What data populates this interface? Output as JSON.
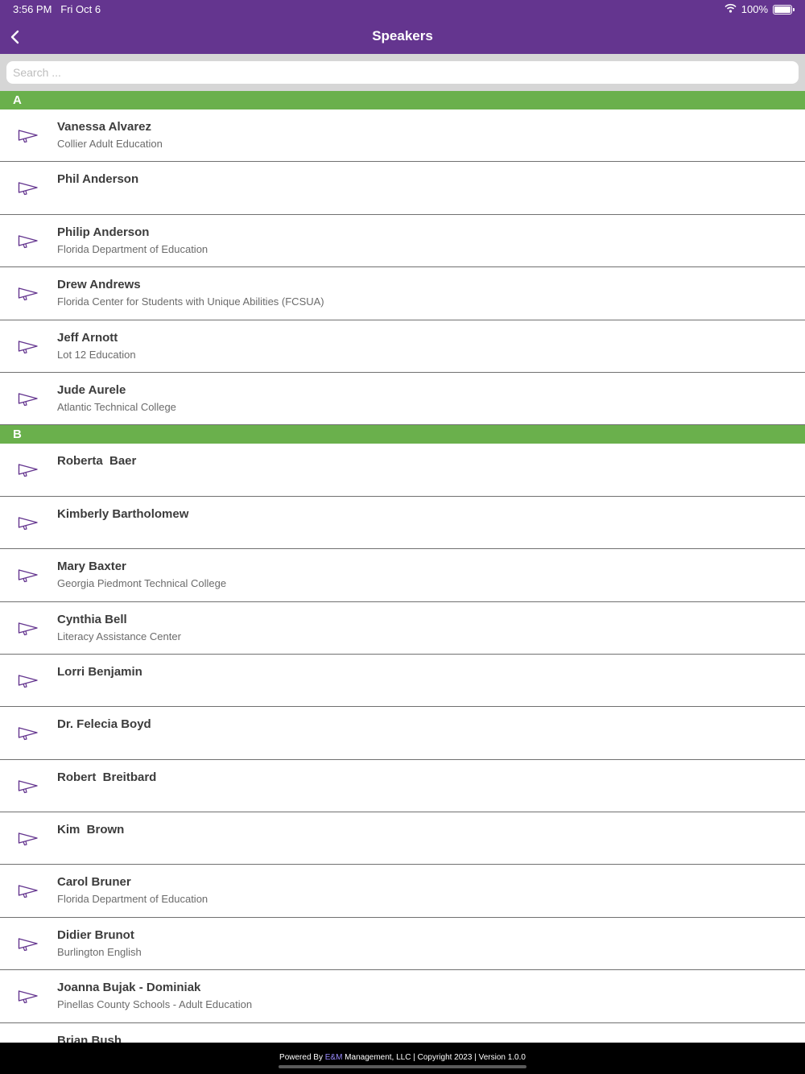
{
  "status": {
    "time": "3:56 PM",
    "date": "Fri Oct 6",
    "battery": "100%",
    "battery_level": 1.0
  },
  "nav": {
    "title": "Speakers",
    "back_icon": "chevron-left-icon"
  },
  "search": {
    "placeholder": "Search ...",
    "value": ""
  },
  "row_icon": "megaphone-icon",
  "accent_color": "#64358f",
  "section_color": "#6ab04c",
  "sections": [
    {
      "letter": "A",
      "speakers": [
        {
          "name": "Vanessa Alvarez",
          "org": "Collier Adult Education"
        },
        {
          "name": "Phil Anderson",
          "org": ""
        },
        {
          "name": "Philip Anderson",
          "org": "Florida Department of Education"
        },
        {
          "name": "Drew Andrews",
          "org": "Florida Center for Students with Unique Abilities (FCSUA)"
        },
        {
          "name": "Jeff Arnott",
          "org": "Lot 12 Education"
        },
        {
          "name": "Jude Aurele",
          "org": "Atlantic Technical College"
        }
      ]
    },
    {
      "letter": "B",
      "speakers": [
        {
          "name": "Roberta  Baer",
          "org": ""
        },
        {
          "name": "Kimberly Bartholomew",
          "org": ""
        },
        {
          "name": "Mary Baxter",
          "org": "Georgia Piedmont Technical College"
        },
        {
          "name": "Cynthia Bell",
          "org": "Literacy Assistance Center"
        },
        {
          "name": "Lorri Benjamin",
          "org": ""
        },
        {
          "name": "Dr. Felecia Boyd",
          "org": ""
        },
        {
          "name": "Robert  Breitbard",
          "org": ""
        },
        {
          "name": "Kim  Brown",
          "org": ""
        },
        {
          "name": "Carol Bruner",
          "org": "Florida Department of Education"
        },
        {
          "name": "Didier Brunot",
          "org": "Burlington English"
        },
        {
          "name": "Joanna Bujak - Dominiak",
          "org": "Pinellas County Schools - Adult Education"
        },
        {
          "name": "Brian Bush",
          "org": ""
        }
      ]
    }
  ],
  "footer": {
    "prefix": "Powered By ",
    "brand": "E&M",
    "suffix": " Management, LLC | Copyright 2023 | Version 1.0.0"
  }
}
